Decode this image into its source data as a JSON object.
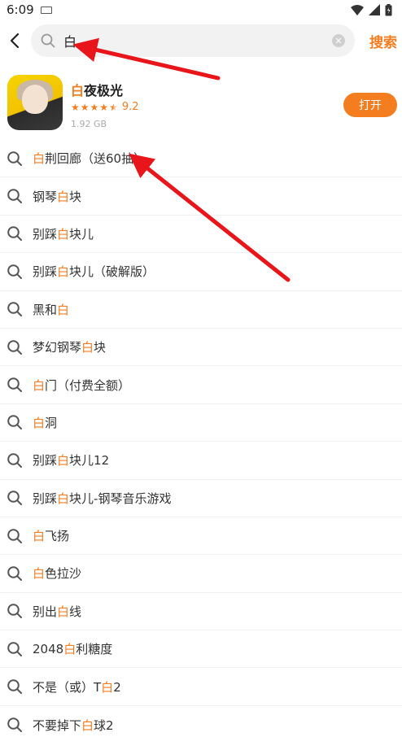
{
  "status": {
    "time": "6:09"
  },
  "search": {
    "query": "白",
    "submit_label": "搜索"
  },
  "app": {
    "name_highlight": "白",
    "name_rest": "夜极光",
    "rating": "9.2",
    "stars": 4.5,
    "size": "1.92 GB",
    "open_label": "打开"
  },
  "suggestions": [
    {
      "pre": "",
      "hl": "白",
      "post": "荆回廊（送60抽）"
    },
    {
      "pre": "钢琴",
      "hl": "白",
      "post": "块"
    },
    {
      "pre": "别踩",
      "hl": "白",
      "post": "块儿"
    },
    {
      "pre": "别踩",
      "hl": "白",
      "post": "块儿（破解版）"
    },
    {
      "pre": "黑和",
      "hl": "白",
      "post": ""
    },
    {
      "pre": "梦幻钢琴",
      "hl": "白",
      "post": "块"
    },
    {
      "pre": "",
      "hl": "白",
      "post": "门（付费全额）"
    },
    {
      "pre": "",
      "hl": "白",
      "post": "洞"
    },
    {
      "pre": "别踩",
      "hl": "白",
      "post": "块儿12"
    },
    {
      "pre": "别踩",
      "hl": "白",
      "post": "块儿-钢琴音乐游戏"
    },
    {
      "pre": "",
      "hl": "白",
      "post": "飞扬"
    },
    {
      "pre": "",
      "hl": "白",
      "post": "色拉沙"
    },
    {
      "pre": "别出",
      "hl": "白",
      "post": "线"
    },
    {
      "pre": "2048",
      "hl": "白",
      "post": "利糖度"
    },
    {
      "pre": "不是（或）T",
      "hl": "白",
      "post": "2"
    },
    {
      "pre": "不要掉下",
      "hl": "白",
      "post": "球2"
    }
  ],
  "colors": {
    "accent": "#f47d20",
    "annotation": "#e8161b"
  }
}
